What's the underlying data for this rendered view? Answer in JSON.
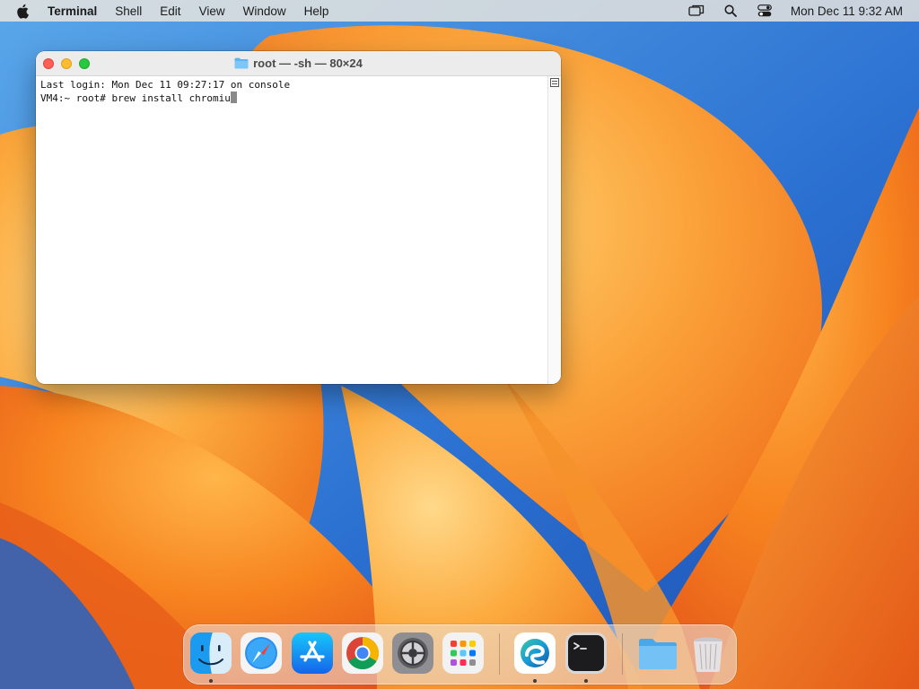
{
  "menubar": {
    "app_name": "Terminal",
    "menus": [
      "Shell",
      "Edit",
      "View",
      "Window",
      "Help"
    ],
    "clock": "Mon Dec 11  9:32 AM",
    "status_icons": [
      "screen-mirroring-icon",
      "spotlight-search-icon",
      "control-center-icon"
    ]
  },
  "terminal": {
    "title": "root — -sh — 80×24",
    "lines": [
      "Last login: Mon Dec 11 09:27:17 on console",
      "VM4:~ root# brew install chromiu"
    ]
  },
  "dock": {
    "apps": [
      {
        "name": "Finder",
        "icon": "finder-icon",
        "running": true
      },
      {
        "name": "Safari",
        "icon": "safari-icon",
        "running": false
      },
      {
        "name": "App Store",
        "icon": "app-store-icon",
        "running": false
      },
      {
        "name": "Google Chrome",
        "icon": "chrome-icon",
        "running": false
      },
      {
        "name": "System Settings",
        "icon": "system-settings-icon",
        "running": false
      },
      {
        "name": "Launchpad",
        "icon": "launchpad-icon",
        "running": false
      },
      {
        "name": "Microsoft Edge",
        "icon": "edge-icon",
        "running": true
      },
      {
        "name": "Terminal",
        "icon": "terminal-icon",
        "running": true
      },
      {
        "name": "Downloads",
        "icon": "folder-icon",
        "running": false
      },
      {
        "name": "Trash",
        "icon": "trash-icon",
        "running": false
      }
    ]
  },
  "colors": {
    "close": "#ff5f57",
    "minimize": "#febc2e",
    "maximize": "#28c840",
    "wallpaper_orange": "#f58a1f",
    "wallpaper_blue": "#2f7fd6"
  }
}
